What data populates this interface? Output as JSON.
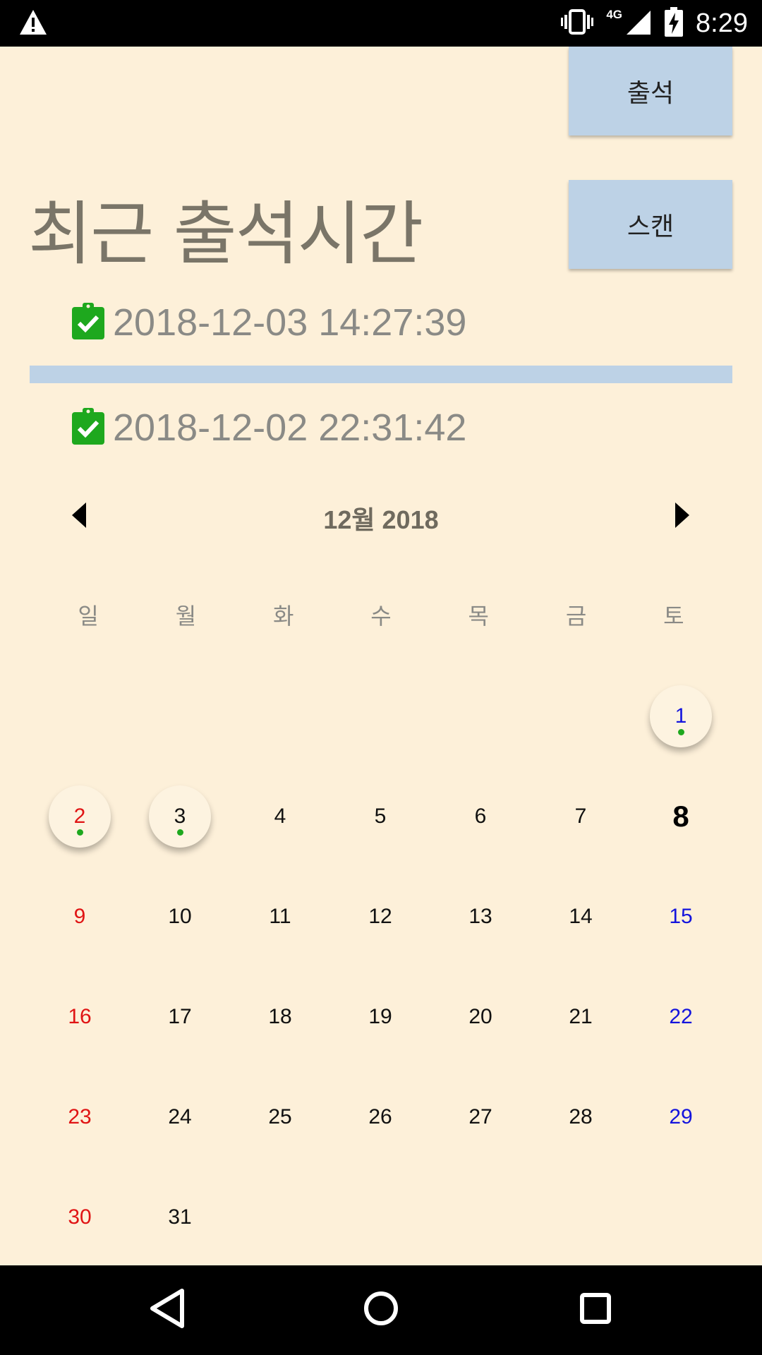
{
  "status_bar": {
    "time": "8:29",
    "network": "4G",
    "icons": [
      "warning-icon",
      "vibrate-icon",
      "signal-icon",
      "battery-charging-icon"
    ]
  },
  "buttons": {
    "attend": "출석",
    "scan": "스캔"
  },
  "section_title": "최근 출석시간",
  "records": [
    {
      "icon": "clipboard-check-icon",
      "timestamp": "2018-12-03 14:27:39"
    },
    {
      "icon": "clipboard-check-icon",
      "timestamp": "2018-12-02 22:31:42"
    }
  ],
  "calendar": {
    "title": "12월 2018",
    "weekdays": [
      "일",
      "월",
      "화",
      "수",
      "목",
      "금",
      "토"
    ],
    "first_weekday_index": 6,
    "days_in_month": 31,
    "today": 8,
    "attended_days": [
      1,
      2,
      3
    ],
    "colors": {
      "sunday": "#e01414",
      "saturday": "#1414dd",
      "attendance_dot": "#1ea81e"
    }
  },
  "colors": {
    "background": "#fdf0d9",
    "button": "#bdd2e6",
    "divider": "#bdd2e6",
    "check_icon": "#1ea81e"
  },
  "nav_bar": {
    "icons": [
      "back-icon",
      "home-icon",
      "recents-icon"
    ]
  }
}
